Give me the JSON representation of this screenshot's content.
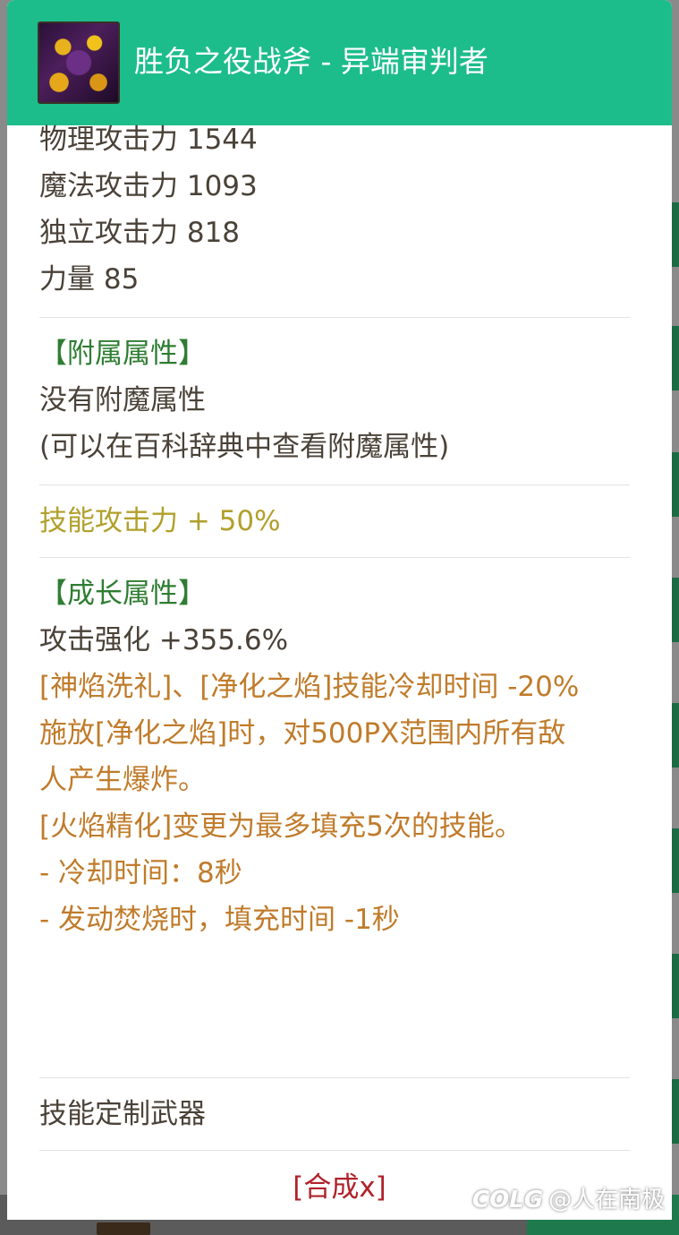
{
  "header": {
    "title": "胜负之役战斧 - 异端审判者",
    "icon": "item-axe-icon"
  },
  "stats": [
    "物理攻击力 1544",
    "魔法攻击力 1093",
    "独立攻击力 818",
    "力量 85"
  ],
  "enchant": {
    "heading": "【附属属性】",
    "none": "没有附魔属性",
    "hint": "(可以在百科辞典中查看附魔属性)"
  },
  "skill_attack": "技能攻击力 + 50%",
  "growth": {
    "heading": "【成长属性】",
    "attack_boost": "攻击强化 +355.6%",
    "effects": [
      "[神焰洗礼]、[净化之焰]技能冷却时间 -20%",
      "施放[净化之焰]时，对500PX范围内所有敌",
      "人产生爆炸。",
      "[火焰精化]变更为最多填充5次的技能。",
      "- 冷却时间：8秒",
      "- 发动焚烧时，填充时间 -1秒"
    ]
  },
  "footer": {
    "type_label": "技能定制武器",
    "synth_link": "[合成x]"
  },
  "watermark": {
    "logo": "COLG",
    "text": "@人在南极"
  },
  "colors": {
    "header_bg": "#1dbd8b",
    "heading_green": "#2e7d32",
    "skill_gold": "#b1a02b",
    "effect_orange": "#c07b2a",
    "synth_red": "#b0222a"
  }
}
